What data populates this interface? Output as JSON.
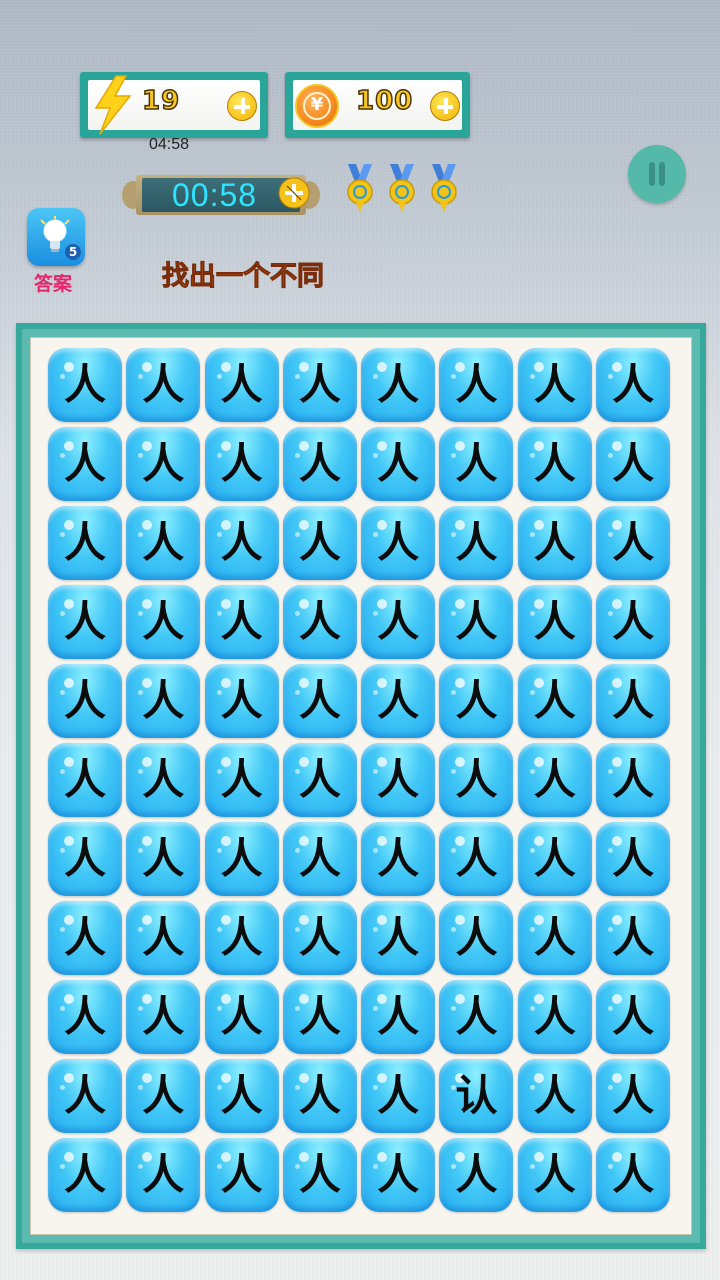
{
  "resources": {
    "energy": {
      "value": "19",
      "regen_timer": "04:58",
      "icon": "lightning-bolt-icon"
    },
    "coins": {
      "value": "100",
      "icon": "yen-coin-icon",
      "symbol": "¥"
    }
  },
  "level_timer": {
    "value": "00:58"
  },
  "medals": {
    "count": 3,
    "icon": "medal-icon"
  },
  "hint": {
    "label": "答案",
    "count": "5",
    "icon": "lightbulb-icon"
  },
  "instruction": "找出一个不同",
  "colors": {
    "accent_teal": "#36a89c",
    "tile_blue": "#23aaf0",
    "gold": "#f6c624",
    "hint_pink": "#e5266a",
    "instruction_orange": "#f0772a"
  },
  "grid": {
    "columns": 8,
    "rows": 11,
    "tiles": [
      [
        "人",
        "人",
        "人",
        "人",
        "人",
        "人",
        "人",
        "人"
      ],
      [
        "人",
        "人",
        "人",
        "人",
        "人",
        "人",
        "人",
        "人"
      ],
      [
        "人",
        "人",
        "人",
        "人",
        "人",
        "人",
        "人",
        "人"
      ],
      [
        "人",
        "人",
        "人",
        "人",
        "人",
        "人",
        "人",
        "人"
      ],
      [
        "人",
        "人",
        "人",
        "人",
        "人",
        "人",
        "人",
        "人"
      ],
      [
        "人",
        "人",
        "人",
        "人",
        "人",
        "人",
        "人",
        "人"
      ],
      [
        "人",
        "人",
        "人",
        "人",
        "人",
        "人",
        "人",
        "人"
      ],
      [
        "人",
        "人",
        "人",
        "人",
        "人",
        "人",
        "人",
        "人"
      ],
      [
        "人",
        "人",
        "人",
        "人",
        "人",
        "人",
        "人",
        "人"
      ],
      [
        "人",
        "人",
        "人",
        "人",
        "人",
        "认",
        "人",
        "人"
      ],
      [
        "人",
        "人",
        "人",
        "人",
        "人",
        "人",
        "人",
        "人"
      ]
    ]
  }
}
